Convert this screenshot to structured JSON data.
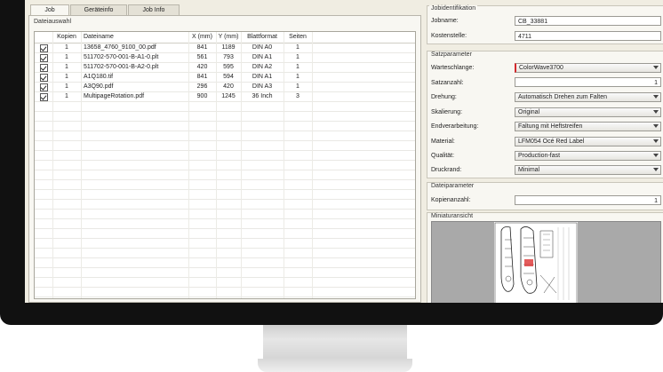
{
  "tabs": [
    {
      "label": "Job"
    },
    {
      "label": "Geräteinfo"
    },
    {
      "label": "Job Info"
    }
  ],
  "left": {
    "group_title": "Dateiauswahl",
    "columns": [
      "Kopien",
      "Dateiname",
      "X (mm)",
      "Y (mm)",
      "Blattformat",
      "Seiten"
    ],
    "rows": [
      {
        "copies": "1",
        "name": "13658_4760_9100_00.pdf",
        "x": "841",
        "y": "1189",
        "format": "DIN A0",
        "pages": "1"
      },
      {
        "copies": "1",
        "name": "511702-570-001-B-A1-0.plt",
        "x": "561",
        "y": "793",
        "format": "DIN A1",
        "pages": "1"
      },
      {
        "copies": "1",
        "name": "511702-570-001-B-A2-0.plt",
        "x": "420",
        "y": "595",
        "format": "DIN A2",
        "pages": "1"
      },
      {
        "copies": "1",
        "name": "A1Q180.tif",
        "x": "841",
        "y": "594",
        "format": "DIN A1",
        "pages": "1"
      },
      {
        "copies": "1",
        "name": "A3Q90.pdf",
        "x": "296",
        "y": "420",
        "format": "DIN A3",
        "pages": "1"
      },
      {
        "copies": "1",
        "name": "MultipageRotation.pdf",
        "x": "900",
        "y": "1245",
        "format": "36 Inch",
        "pages": "3"
      }
    ]
  },
  "right": {
    "jobid": {
      "title": "Jobidentifikation",
      "jobname_label": "Jobname:",
      "jobname_value": "CB_33881",
      "kostenstelle_label": "Kostenstelle:",
      "kostenstelle_value": "4711"
    },
    "satz": {
      "title": "Satzparameter",
      "warteschlange_label": "Warteschlange:",
      "warteschlange_value": "ColorWave3700",
      "satzanzahl_label": "Satzanzahl:",
      "satzanzahl_value": "1",
      "drehung_label": "Drehung:",
      "drehung_value": "Automatisch Drehen zum Falten",
      "skalierung_label": "Skalierung:",
      "skalierung_value": "Original",
      "endverarbeitung_label": "Endverarbeitung:",
      "endverarbeitung_value": "Faltung mit Heftstreifen",
      "material_label": "Material:",
      "material_value": "LFM054 Océ Red Label",
      "qualitaet_label": "Qualität:",
      "qualitaet_value": "Production-fast",
      "druckrand_label": "Druckrand:",
      "druckrand_value": "Minimal"
    },
    "datei": {
      "title": "Dateiparameter",
      "kopien_label": "Kopienanzahl:",
      "kopien_value": "1"
    },
    "mini": {
      "title": "Miniaturansicht"
    }
  },
  "colors": {
    "window_bg": "#f0ede2",
    "queue_marker": "#d4292d",
    "bezel": "#111111"
  }
}
